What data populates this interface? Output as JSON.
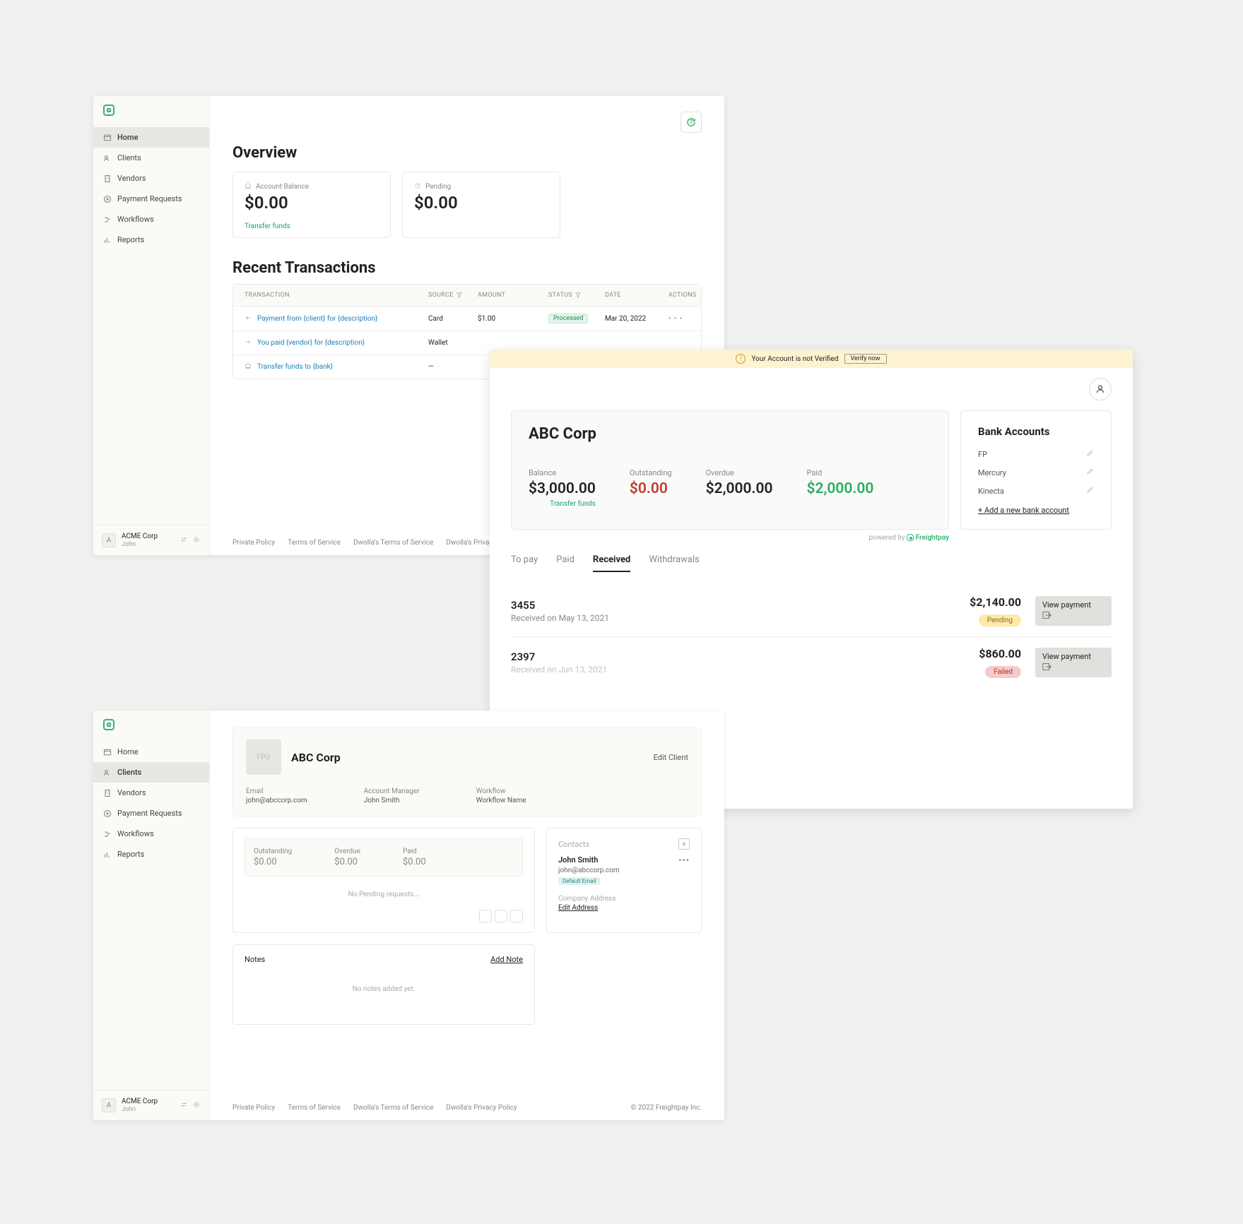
{
  "sidebar": {
    "company": "ACME Corp",
    "user": "John",
    "avatar_initial": "A",
    "items": [
      {
        "label": "Home"
      },
      {
        "label": "Clients"
      },
      {
        "label": "Vendors"
      },
      {
        "label": "Payment Requests"
      },
      {
        "label": "Workflows"
      },
      {
        "label": "Reports"
      }
    ]
  },
  "footer": {
    "private_policy": "Private Policy",
    "terms": "Terms of Service",
    "dwolla_terms": "Dwolla's Terms of Service",
    "dwolla_privacy": "Dwolla's Privacy Policy",
    "copyright": "© 2022 Freightpay Inc."
  },
  "panel1": {
    "overview_title": "Overview",
    "cards": {
      "balance_label": "Account Balance",
      "balance_value": "$0.00",
      "transfer_link": "Transfer funds",
      "pending_label": "Pending",
      "pending_value": "$0.00"
    },
    "recent_title": "Recent Transactions",
    "table": {
      "cols": {
        "transaction": "TRANSACTION",
        "source": "SOURCE",
        "amount": "AMOUNT",
        "status": "STATUS",
        "date": "DATE",
        "actions": "ACTIONS"
      },
      "rows": [
        {
          "desc": "Payment from {client} for {description}",
          "source": "Card",
          "amount": "$1.00",
          "status": "Processed",
          "date": "Mar 20, 2022"
        },
        {
          "desc": "You paid {vendor} for {description}",
          "source": "Wallet",
          "amount": "",
          "status": "",
          "date": ""
        },
        {
          "desc": "Transfer funds to {bank}",
          "source": "—",
          "amount": "",
          "status": "",
          "date": ""
        }
      ]
    }
  },
  "panel2": {
    "banner_text": "Your Account is not Verified",
    "verify_btn": "Verify now",
    "company": "ABC Corp",
    "stats": {
      "balance_label": "Balance",
      "balance_value": "$3,000.00",
      "transfer_link": "Transfer funds",
      "outstanding_label": "Outstanding",
      "outstanding_value": "$0.00",
      "overdue_label": "Overdue",
      "overdue_value": "$2,000.00",
      "paid_label": "Paid",
      "paid_value": "$2,000.00"
    },
    "bank": {
      "title": "Bank Accounts",
      "rows": [
        "FP",
        "Mercury",
        "Kinecta"
      ],
      "add": "+ Add a new bank account"
    },
    "powered_prefix": "powered by",
    "powered_brand": "Freightpay",
    "tabs": {
      "to_pay": "To pay",
      "paid": "Paid",
      "received": "Received",
      "withdrawals": "Withdrawals"
    },
    "payments": [
      {
        "id": "3455",
        "meta": "Received on May 13, 2021",
        "amount": "$2,140.00",
        "status": "Pending",
        "view": "View payment"
      },
      {
        "id": "2397",
        "meta": "Received on Jun 13, 2021",
        "amount": "$860.00",
        "status": "Failed",
        "view": "View payment"
      }
    ]
  },
  "panel3": {
    "client": {
      "name": "ABC Corp",
      "logo_text": "FPO",
      "edit": "Edit Client",
      "email_label": "Email",
      "email": "john@abccorp.com",
      "manager_label": "Account Manager",
      "manager": "John Smith",
      "workflow_label": "Workflow",
      "workflow": "Workflow Name"
    },
    "fin": {
      "outstanding_label": "Outstanding",
      "outstanding_value": "$0.00",
      "overdue_label": "Overdue",
      "overdue_value": "$0.00",
      "paid_label": "Paid",
      "paid_value": "$0.00",
      "empty": "No Pending requests..."
    },
    "contacts": {
      "header": "Contacts",
      "name": "John Smith",
      "email": "john@abccorp.com",
      "default_pill": "Default Email",
      "address_header": "Company Address",
      "edit_address": "Edit Address"
    },
    "notes": {
      "header": "Notes",
      "add": "Add Note",
      "empty": "No notes added yet."
    }
  }
}
